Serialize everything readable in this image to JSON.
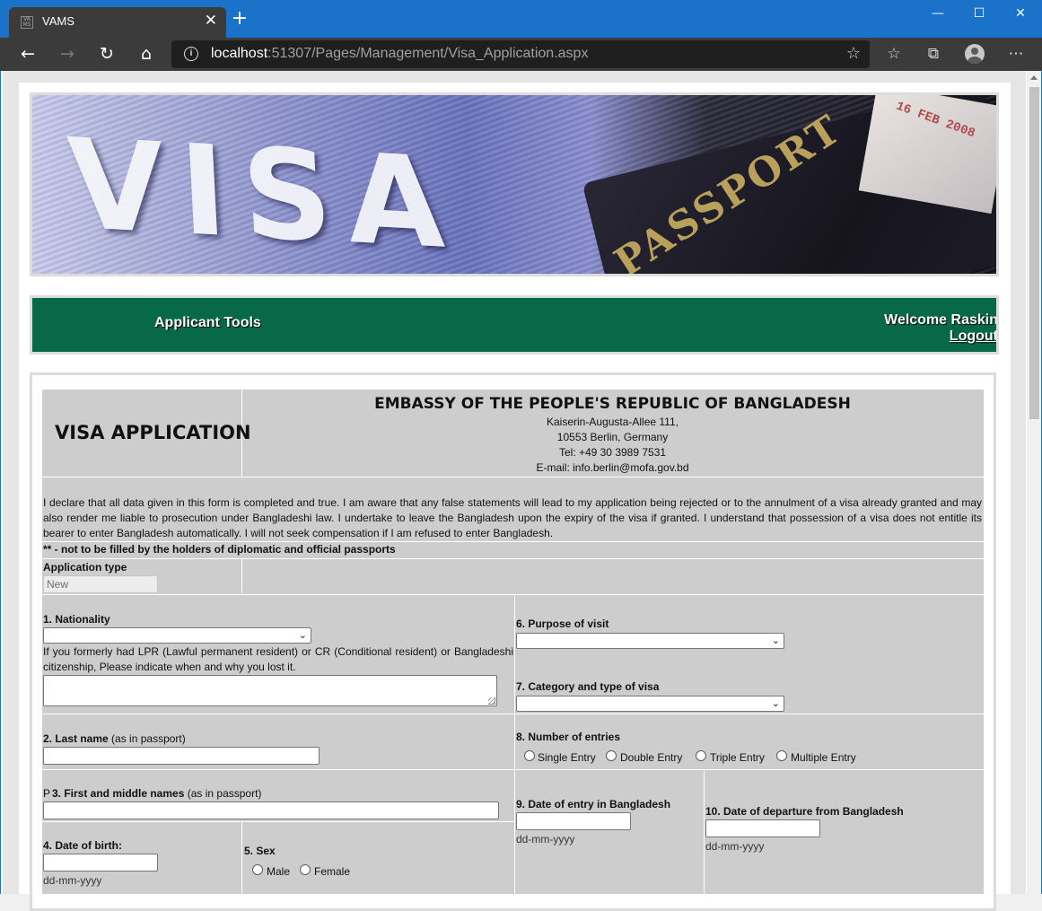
{
  "browser": {
    "tab_title": "VAMS",
    "tab_close": "✕",
    "new_tab": "+",
    "minimize": "—",
    "maximize": "☐",
    "close": "✕",
    "url_host": "localhost",
    "url_rest": ":51307/Pages/Management/Visa_Application.aspx"
  },
  "nav": {
    "applicant_tools": "Applicant Tools",
    "welcome": "Welcome Raskin",
    "logout": "Logout"
  },
  "header": {
    "form_title": "VISA APPLICATION",
    "embassy": "EMBASSY OF THE PEOPLE'S REPUBLIC OF BANGLADESH",
    "address_line1": "Kaiserin-Augusta-Allee 111,",
    "address_line2": "10553 Berlin, Germany",
    "tel": "Tel: +49 30 3989 7531",
    "email": "E-mail: info.berlin@mofa.gov.bd"
  },
  "declaration": {
    "text": "I declare that all data given in this form is completed and true. I am aware that any false statements will lead to my application being rejected or to the annulment of a visa already granted and may also render me liable to prosecution under Bangladeshi law. I undertake to leave the Bangladesh upon the expiry of the visa if granted. I understand that possession of a visa does not entitle its bearer to enter Bangladesh automatically. I will not seek compensation if I am refused to enter Bangladesh.",
    "note": "** - not to be filled by the holders of diplomatic and official passports"
  },
  "application_type": {
    "label": "Application type",
    "value": "New"
  },
  "fields": {
    "nationality_label": "1. Nationality",
    "lpr_note": "If you formerly had LPR (Lawful permanent resident) or CR (Conditional resident) or Bangladeshi citizenship, Please indicate when and why you lost it.",
    "purpose_label": "6. Purpose of visit",
    "category_label": "7. Category and type of visa",
    "last_name_label": "2. Last name",
    "last_name_hint": "(as in passport)",
    "entries_label": "8. Number of entries",
    "entries_options": [
      "Single Entry",
      "Double Entry",
      "Triple Entry",
      "Multiple Entry"
    ],
    "first_name_prefix": "P",
    "first_name_label": "3. First and middle names",
    "first_name_hint": "(as in passport)",
    "entry_date_label": "9. Date of entry in Bangladesh",
    "departure_date_label": "10. Date of departure from Bangladesh",
    "dob_label": "4. Date of birth:",
    "sex_label": "5. Sex",
    "sex_options": [
      "Male",
      "Female"
    ],
    "date_format": "dd-mm-yyyy"
  }
}
